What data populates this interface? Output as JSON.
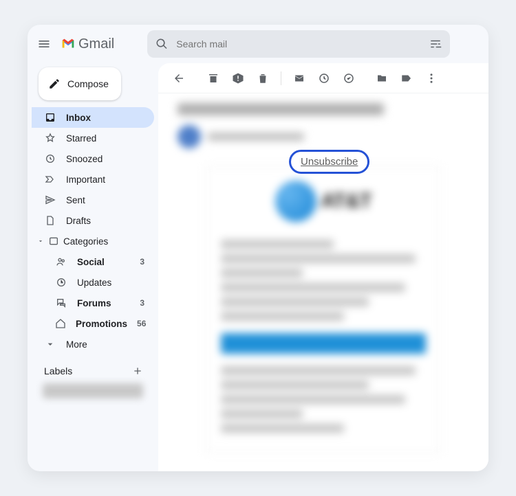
{
  "header": {
    "app_name": "Gmail",
    "search_placeholder": "Search mail"
  },
  "compose_label": "Compose",
  "nav": {
    "inbox": "Inbox",
    "starred": "Starred",
    "snoozed": "Snoozed",
    "important": "Important",
    "sent": "Sent",
    "drafts": "Drafts",
    "categories": "Categories",
    "more": "More"
  },
  "categories": {
    "social": {
      "label": "Social",
      "count": "3"
    },
    "updates": {
      "label": "Updates",
      "count": ""
    },
    "forums": {
      "label": "Forums",
      "count": "3"
    },
    "promotions": {
      "label": "Promotions",
      "count": "56"
    }
  },
  "labels_header": "Labels",
  "message": {
    "unsubscribe": "Unsubscribe",
    "brand": "AT&T"
  }
}
